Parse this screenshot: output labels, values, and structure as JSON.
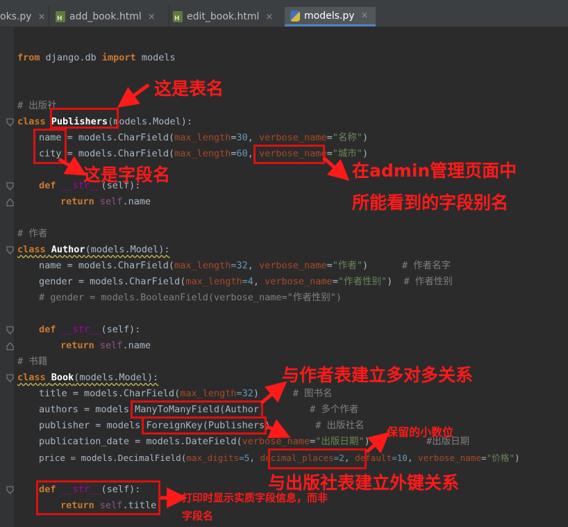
{
  "tabs": [
    {
      "label": "oks.py",
      "icon": "python-file-icon",
      "active": false
    },
    {
      "label": "add_book.html",
      "icon": "html-file-icon",
      "active": false
    },
    {
      "label": "edit_book.html",
      "icon": "html-file-icon",
      "active": false
    },
    {
      "label": "models.py",
      "icon": "python-file-icon",
      "active": true
    }
  ],
  "close_glyph": "×",
  "code": {
    "l1_from": "from",
    "l1_mod": " django.db ",
    "l1_import": "import",
    "l1_rest": " models",
    "c_publisher": "# 出版社",
    "pub_class": "class",
    "pub_name": "Publishers",
    "pub_base": "(models.Model):",
    "f_name": "name",
    "f_name_mid": " = models.CharField(",
    "f_name_p1": "max_length",
    "f_name_eq1": "=",
    "f_name_v1": "30",
    "f_name_comma": ", ",
    "f_name_p2": "verbose_name",
    "f_name_eq2": "=",
    "f_name_v2": "\"名称\"",
    "f_name_end": ")",
    "f_city": "city",
    "f_city_mid": " = models.CharField(",
    "f_city_p1": "max_length",
    "f_city_eq1": "=",
    "f_city_v1": "60",
    "f_city_comma": ", ",
    "f_city_p2": "verbose_name",
    "f_city_eq2": "=",
    "f_city_v2": "\"城市\"",
    "f_city_end": ")",
    "def": "def",
    "str_fn": "__str__",
    "self_sig": "(self):",
    "return": "return",
    "self": "self",
    "ret_name": ".name",
    "ret_title": ".title",
    "c_author": "# 作者",
    "au_class": "class",
    "au_name": "Author",
    "au_base": "(models.Model):",
    "au_f1": "name = models.CharField(",
    "au_f1_p1": "max_length",
    "au_f1_v1": "=32",
    "au_f1_c": ", ",
    "au_f1_p2": "verbose_name",
    "au_f1_v2": "=",
    "au_f1_s": "\"作者\"",
    "au_f1_end": ")",
    "au_f1_cm": "      # 作者名字",
    "au_f2": "gender = models.CharField(",
    "au_f2_p1": "max_length",
    "au_f2_v1": "=4",
    "au_f2_c": ", ",
    "au_f2_p2": "verbose_name",
    "au_f2_v2": "=",
    "au_f2_s": "\"作者性别\"",
    "au_f2_end": ")",
    "au_f2_cm": "  # 作者性别",
    "au_f3": "# gender = models.BooleanField(verbose_name=\"作者性别\")",
    "c_book": "# 书籍",
    "bk_class": "class",
    "bk_name": "Book",
    "bk_base": "(models.Model):",
    "bk_f1": "title = models.CharField(",
    "bk_f1_p": "max_length",
    "bk_f1_v": "=32",
    "bk_f1_end": ")",
    "bk_f1_cm": "      # 图书名",
    "bk_f2a": "authors = models.",
    "bk_f2b": "ManyToManyField(Author)",
    "bk_f2_cm": "        # 多个作者",
    "bk_f3a": "publisher = models.",
    "bk_f3b": "ForeignKey(Publishers)",
    "bk_f3_cm": "        # 出版社名",
    "bk_f4": "publication_date = models.DateField(",
    "bk_f4_p": "verbose_name",
    "bk_f4_eq": "=",
    "bk_f4_s": "\"出版日期\"",
    "bk_f4_end": ")",
    "bk_f4_cm": "          #出版日期",
    "bk_f5": "price = models.DecimalField(",
    "bk_f5_p1": "max_digits",
    "bk_f5_v1": "=5",
    "bk_f5_c1": ", ",
    "bk_f5_p2": "decimal_places",
    "bk_f5_v2": "=2",
    "bk_f5_c2": ", ",
    "bk_f5_p3": "default",
    "bk_f5_v3": "=10",
    "bk_f5_c3": ", ",
    "bk_f5_p4": "verbose_name",
    "bk_f5_eq": "=",
    "bk_f5_s": "\"价格\"",
    "bk_f5_end": ")"
  },
  "annotations": {
    "table_name": "这是表名",
    "field_name": "这是字段名",
    "admin_line1": "在admin管理页面中",
    "admin_line2": "所能看到的字段别名",
    "many_to_many": "与作者表建立多对多关系",
    "decimal": "保留的小数位",
    "foreign_key": "与出版社表建立外键关系",
    "print_line1": "打印时显示实质字段信息，而非",
    "print_line2": "字段名"
  },
  "colors": {
    "annotation": "#ff1a1a",
    "background": "#2b2b2b",
    "keyword": "#cc7832",
    "string": "#6a8759",
    "number": "#6897bb"
  }
}
